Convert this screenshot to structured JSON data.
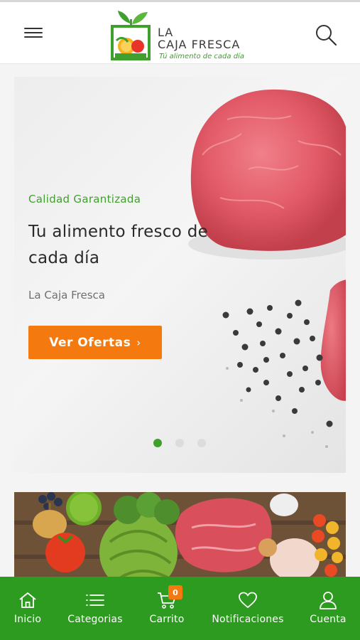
{
  "header": {
    "brand_line1": "LA",
    "brand_line2": "CAJA FRESCA",
    "tagline": "Tú alimento de cada día",
    "menu_icon": "hamburger-icon",
    "search_icon": "search-icon"
  },
  "hero": {
    "subtitle": "Calidad Garantizada",
    "title": "Tu alimento fresco de cada día",
    "brand": "La Caja Fresca",
    "cta_label": "Ver Ofertas",
    "cta_chevron": "›",
    "slide_count": 3,
    "active_slide": 1
  },
  "bottom_nav": {
    "items": [
      {
        "label": "Inicio",
        "icon": "home-icon"
      },
      {
        "label": "Categorias",
        "icon": "list-icon"
      },
      {
        "label": "Carrito",
        "icon": "cart-icon",
        "badge": "0"
      },
      {
        "label": "Notificaciones",
        "icon": "heart-icon"
      },
      {
        "label": "Cuenta",
        "icon": "user-icon"
      }
    ]
  },
  "colors": {
    "brand_green": "#2d9a20",
    "accent_green": "#3fa02e",
    "cta_orange": "#f47a10"
  }
}
